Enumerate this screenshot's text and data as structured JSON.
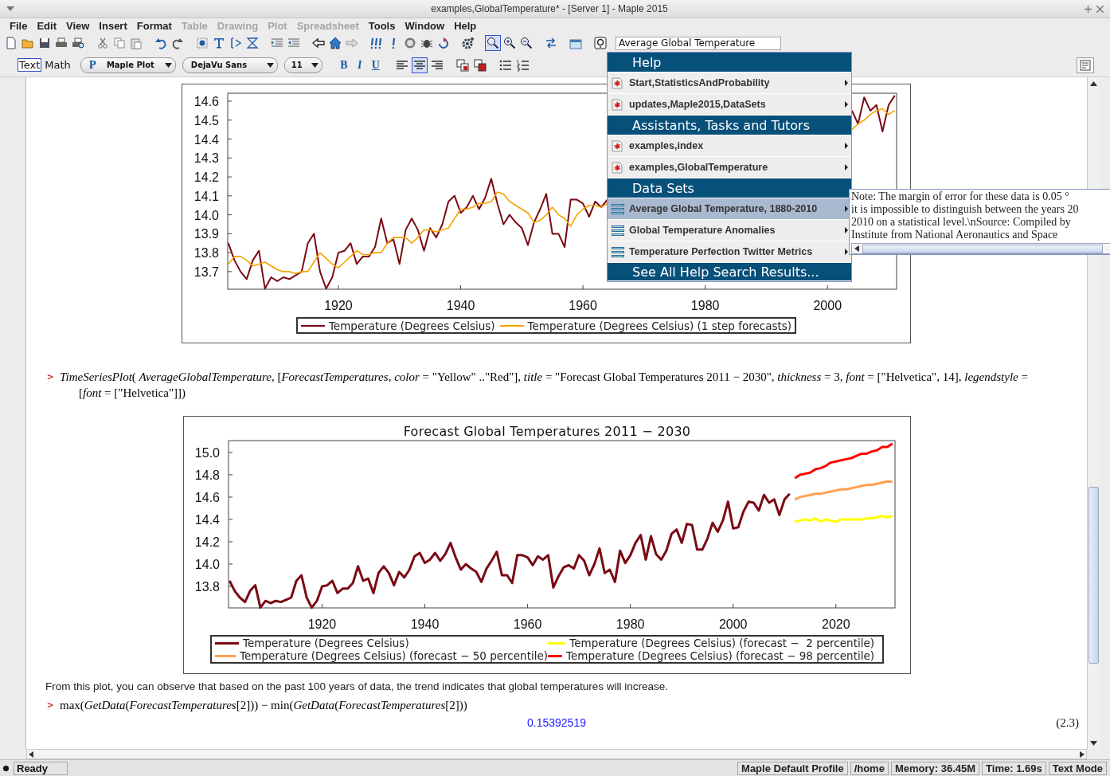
{
  "window": {
    "title": "examples,GlobalTemperature* - [Server 1] - Maple 2015"
  },
  "menu_bar": [
    {
      "label": "File",
      "disabled": false
    },
    {
      "label": "Edit",
      "disabled": false
    },
    {
      "label": "View",
      "disabled": false
    },
    {
      "label": "Insert",
      "disabled": false
    },
    {
      "label": "Format",
      "disabled": false
    },
    {
      "label": "Table",
      "disabled": true
    },
    {
      "label": "Drawing",
      "disabled": true
    },
    {
      "label": "Plot",
      "disabled": true
    },
    {
      "label": "Spreadsheet",
      "disabled": true
    },
    {
      "label": "Tools",
      "disabled": false
    },
    {
      "label": "Window",
      "disabled": false
    },
    {
      "label": "Help",
      "disabled": false
    }
  ],
  "toolbar": {
    "items": [
      {
        "kind": "new",
        "selected": false
      },
      {
        "kind": "open",
        "selected": false
      },
      {
        "kind": "save",
        "selected": false
      },
      {
        "kind": "print",
        "selected": false
      },
      {
        "kind": "preview",
        "selected": false
      },
      {
        "kind": "separator"
      },
      {
        "kind": "cut",
        "selected": false
      },
      {
        "kind": "copy",
        "selected": false
      },
      {
        "kind": "paste",
        "selected": false
      },
      {
        "kind": "separator"
      },
      {
        "kind": "undo",
        "selected": false
      },
      {
        "kind": "redo",
        "selected": false
      },
      {
        "kind": "separator"
      },
      {
        "kind": "group",
        "selected": false
      },
      {
        "kind": "text",
        "selected": false
      },
      {
        "kind": "prompt",
        "selected": false
      },
      {
        "kind": "section",
        "selected": false
      },
      {
        "kind": "separator"
      },
      {
        "kind": "indent",
        "selected": false
      },
      {
        "kind": "outdent",
        "selected": false
      },
      {
        "kind": "separator"
      },
      {
        "kind": "back",
        "selected": false
      },
      {
        "kind": "home",
        "selected": false
      },
      {
        "kind": "forward",
        "selected": false
      },
      {
        "kind": "separator"
      },
      {
        "kind": "execute-all",
        "selected": false
      },
      {
        "kind": "execute",
        "selected": false
      },
      {
        "kind": "stop",
        "selected": false
      },
      {
        "kind": "debug",
        "selected": false
      },
      {
        "kind": "restart",
        "selected": false
      },
      {
        "kind": "separator"
      },
      {
        "kind": "gear",
        "selected": false
      },
      {
        "kind": "separator"
      },
      {
        "kind": "zoom-fit",
        "selected": true
      },
      {
        "kind": "zoom-in",
        "selected": false
      },
      {
        "kind": "zoom-out",
        "selected": false
      },
      {
        "kind": "separator"
      },
      {
        "kind": "swap",
        "selected": false
      },
      {
        "kind": "separator"
      },
      {
        "kind": "insert",
        "selected": false
      },
      {
        "kind": "separator"
      },
      {
        "kind": "help",
        "selected": false
      }
    ],
    "search": {
      "value": "Average Global Temperature"
    }
  },
  "format_bar": {
    "modes": [
      {
        "label": "Text",
        "selected": true
      },
      {
        "label": "Math",
        "selected": false
      }
    ],
    "style": {
      "prefix": "P",
      "value": "Maple Plot"
    },
    "font": {
      "value": "DejaVu Sans"
    },
    "size": {
      "value": "11"
    },
    "text_styles": [
      {
        "label": "B",
        "kind": "bold",
        "selected": false
      },
      {
        "label": "I",
        "kind": "italic",
        "selected": false
      },
      {
        "label": "U",
        "kind": "underline",
        "selected": false
      }
    ],
    "alignments": [
      {
        "kind": "left",
        "selected": false
      },
      {
        "kind": "center",
        "selected": true
      },
      {
        "kind": "right",
        "selected": false
      }
    ]
  },
  "document": {
    "plot_1": {
      "chart_data": {
        "type": "line",
        "legend": "bottom",
        "xlim": [
          1901.9,
          2011.3
        ],
        "ylim": [
          13.607,
          14.642
        ],
        "xticks": [
          1920,
          1940,
          1960,
          1980,
          2000
        ],
        "yticks": [
          13.7,
          13.8,
          13.9,
          {
            "value": 14,
            "label": "14.0"
          },
          14.1,
          14.2,
          14.3,
          14.4,
          14.5,
          14.6
        ],
        "x": [
          1902,
          1903,
          1904,
          1905,
          1906,
          1907,
          1908,
          1909,
          1910,
          1911,
          1912,
          1913,
          1914,
          1915,
          1916,
          1917,
          1918,
          1919,
          1920,
          1921,
          1922,
          1923,
          1924,
          1925,
          1926,
          1927,
          1928,
          1929,
          1930,
          1931,
          1932,
          1933,
          1934,
          1935,
          1936,
          1937,
          1938,
          1939,
          1940,
          1941,
          1942,
          1943,
          1944,
          1945,
          1946,
          1947,
          1948,
          1949,
          1950,
          1951,
          1952,
          1953,
          1954,
          1955,
          1956,
          1957,
          1958,
          1959,
          1960,
          1961,
          1962,
          1963,
          1964,
          null,
          null,
          null,
          null,
          null,
          null,
          null,
          null,
          null,
          null,
          null,
          null,
          null,
          null,
          null,
          null,
          null,
          null,
          null,
          null,
          null,
          null,
          null,
          null,
          null,
          null,
          null,
          null,
          null,
          null,
          null,
          null,
          null,
          null,
          null,
          null,
          null,
          null,
          null,
          2004,
          2005,
          2006,
          2007,
          2008,
          2009,
          2010,
          2011
        ],
        "series": [
          {
            "name": "Temperature (Degrees Celsius)",
            "color": "#7a0a14",
            "values": [
              13.85,
              13.76,
              13.7,
              13.66,
              13.76,
              13.81,
              13.61,
              13.67,
              13.65,
              13.67,
              13.66,
              13.68,
              13.7,
              13.85,
              13.9,
              13.7,
              13.61,
              13.67,
              13.8,
              13.81,
              13.85,
              13.74,
              13.78,
              13.78,
              13.83,
              13.98,
              13.85,
              13.87,
              13.74,
              13.92,
              13.98,
              13.92,
              13.81,
              13.93,
              13.88,
              13.95,
              14.07,
              14.1,
              14.01,
              14.04,
              14.1,
              14.03,
              14.09,
              14.19,
              14.06,
              13.95,
              14.0,
              13.96,
              13.93,
              13.84,
              13.96,
              14.03,
              14.11,
              13.9,
              13.9,
              13.83,
              14.08,
              14.08,
              14.06,
              13.99,
              14.07,
              14.04,
              14.08,
              null,
              null,
              null,
              null,
              null,
              null,
              null,
              null,
              null,
              null,
              null,
              null,
              null,
              null,
              null,
              null,
              null,
              null,
              null,
              null,
              null,
              null,
              null,
              null,
              null,
              null,
              null,
              null,
              null,
              null,
              null,
              null,
              null,
              null,
              null,
              null,
              null,
              null,
              null,
              14.55,
              14.48,
              14.62,
              14.55,
              14.58,
              14.44,
              14.58,
              14.63
            ]
          },
          {
            "name": "Temperature (Degrees Celsius) (1 step forecasts)",
            "color": "#f5a300",
            "values": [
              13.74,
              13.78,
              13.78,
              13.76,
              13.73,
              13.74,
              13.75,
              13.73,
              13.71,
              13.7,
              13.7,
              13.69,
              13.7,
              13.7,
              13.75,
              13.8,
              13.77,
              13.74,
              13.72,
              13.75,
              13.78,
              13.81,
              13.79,
              13.79,
              13.8,
              13.8,
              13.85,
              13.88,
              13.88,
              13.88,
              13.85,
              13.88,
              13.92,
              13.92,
              13.91,
              13.92,
              13.93,
              13.98,
              14.03,
              14.03,
              14.04,
              14.06,
              14.06,
              14.07,
              14.12,
              14.11,
              14.07,
              14.05,
              14.03,
              14.01,
              13.96,
              13.97,
              14.0,
              14.04,
              14.0,
              13.98,
              13.94,
              14.0,
              14.03,
              14.05,
              14.05,
              14.04,
              14.06,
              null,
              null,
              null,
              null,
              null,
              null,
              null,
              null,
              null,
              null,
              null,
              null,
              null,
              null,
              null,
              null,
              null,
              null,
              null,
              null,
              null,
              null,
              null,
              null,
              null,
              null,
              null,
              null,
              null,
              null,
              null,
              null,
              null,
              null,
              null,
              null,
              null,
              null,
              null,
              14.45,
              14.48,
              14.5,
              14.53,
              14.55,
              14.56,
              14.53,
              14.55
            ]
          }
        ]
      }
    },
    "input_1": {
      "prompt": ">",
      "text": "*TimeSeriesPlot*( *AverageGlobalTemperature*, [*ForecastTemperatures*, *color* = \"Yellow\" ..\"Red\"], *title* = \"Forecast Global Temperatures 2011 − 2030\", *thickness* = 3, *font* = [\"Helvetica\", 14], *legendstyle* = [*font* = [\"Helvetica\"]])"
    },
    "plot_2": {
      "chart_data": {
        "type": "line",
        "legend": "bottom",
        "title": "Forecast Global Temperatures 2011 − 2030",
        "xlim": [
          1901.8,
          2031.5
        ],
        "ylim": [
          13.607,
          15.107
        ],
        "xticks": [
          1920,
          1940,
          1960,
          1980,
          2000,
          2020
        ],
        "yticks": [
          13.8,
          {
            "value": 14,
            "label": "14.0"
          },
          14.2,
          14.4,
          14.6,
          14.8,
          {
            "value": 15,
            "label": "15.0"
          }
        ],
        "x": [
          1902,
          1903,
          1904,
          1905,
          1906,
          1907,
          1908,
          1909,
          1910,
          1911,
          1912,
          1913,
          1914,
          1915,
          1916,
          1917,
          1918,
          1919,
          1920,
          1921,
          1922,
          1923,
          1924,
          1925,
          1926,
          1927,
          1928,
          1929,
          1930,
          1931,
          1932,
          1933,
          1934,
          1935,
          1936,
          1937,
          1938,
          1939,
          1940,
          1941,
          1942,
          1943,
          1944,
          1945,
          1946,
          1947,
          1948,
          1949,
          1950,
          1951,
          1952,
          1953,
          1954,
          1955,
          1956,
          1957,
          1958,
          1959,
          1960,
          1961,
          1962,
          1963,
          1964,
          1965,
          1966,
          1967,
          1968,
          1969,
          1970,
          1971,
          1972,
          1973,
          1974,
          1975,
          1976,
          1977,
          1978,
          1979,
          1980,
          1981,
          1982,
          1983,
          1984,
          1985,
          1986,
          1987,
          1988,
          1989,
          1990,
          1991,
          1992,
          1993,
          1994,
          1995,
          1996,
          1997,
          1998,
          1999,
          2000,
          2001,
          2002,
          2003,
          2004,
          2005,
          2006,
          2007,
          2008,
          2009,
          2010,
          2011,
          2012,
          2013,
          2014,
          2015,
          2016,
          2017,
          2018,
          2019,
          2020,
          2021,
          2022,
          2023,
          2024,
          2025,
          2026,
          2027,
          2028,
          2029,
          2030,
          2031
        ],
        "series": [
          {
            "name": "Temperature (Degrees Celsius)",
            "color": "#7a0a14",
            "values": [
              13.85,
              13.76,
              13.7,
              13.66,
              13.76,
              13.81,
              13.61,
              13.67,
              13.65,
              13.67,
              13.66,
              13.68,
              13.7,
              13.85,
              13.9,
              13.7,
              13.61,
              13.67,
              13.8,
              13.81,
              13.85,
              13.74,
              13.78,
              13.78,
              13.83,
              13.98,
              13.85,
              13.87,
              13.74,
              13.92,
              13.98,
              13.92,
              13.81,
              13.93,
              13.88,
              13.95,
              14.07,
              14.1,
              14.01,
              14.04,
              14.1,
              14.03,
              14.09,
              14.19,
              14.06,
              13.95,
              14.0,
              13.96,
              13.93,
              13.84,
              13.96,
              14.03,
              14.11,
              13.9,
              13.9,
              13.83,
              14.08,
              14.08,
              14.06,
              13.99,
              14.07,
              14.04,
              14.08,
              13.79,
              13.89,
              13.97,
              13.99,
              13.96,
              14.08,
              14.03,
              13.9,
              14.0,
              14.14,
              13.92,
              13.95,
              13.84,
              14.12,
              14.01,
              14.08,
              14.19,
              14.26,
              14.04,
              14.25,
              14.09,
              14.04,
              14.12,
              14.27,
              14.31,
              14.19,
              14.36,
              14.35,
              14.13,
              14.13,
              14.23,
              14.37,
              14.29,
              14.39,
              14.56,
              14.32,
              14.33,
              14.47,
              14.56,
              14.55,
              14.48,
              14.62,
              14.55,
              14.58,
              14.44,
              14.58,
              14.63,
              null,
              null,
              null,
              null,
              null,
              null,
              null,
              null,
              null,
              null,
              null,
              null,
              null,
              null,
              null,
              null,
              null,
              null,
              null,
              null
            ]
          },
          {
            "name": "Temperature (Degrees Celsius) (forecast −  2 percentile)",
            "color": "#ffff00",
            "values": [
              null,
              null,
              null,
              null,
              null,
              null,
              null,
              null,
              null,
              null,
              null,
              null,
              null,
              null,
              null,
              null,
              null,
              null,
              null,
              null,
              null,
              null,
              null,
              null,
              null,
              null,
              null,
              null,
              null,
              null,
              null,
              null,
              null,
              null,
              null,
              null,
              null,
              null,
              null,
              null,
              null,
              null,
              null,
              null,
              null,
              null,
              null,
              null,
              null,
              null,
              null,
              null,
              null,
              null,
              null,
              null,
              null,
              null,
              null,
              null,
              null,
              null,
              null,
              null,
              null,
              null,
              null,
              null,
              null,
              null,
              null,
              null,
              null,
              null,
              null,
              null,
              null,
              null,
              null,
              null,
              null,
              null,
              null,
              null,
              null,
              null,
              null,
              null,
              null,
              null,
              null,
              null,
              null,
              null,
              null,
              null,
              null,
              null,
              null,
              null,
              null,
              null,
              null,
              null,
              null,
              null,
              null,
              null,
              null,
              null,
              14.38,
              14.39,
              14.4,
              14.39,
              14.41,
              14.38,
              14.4,
              14.39,
              14.38,
              14.4,
              14.4,
              14.4,
              14.4,
              14.4,
              14.41,
              14.41,
              14.42,
              14.43,
              14.42,
              14.43
            ]
          },
          {
            "name": "Temperature (Degrees Celsius) (forecast − 50 percentile)",
            "color": "#ffa050",
            "values": [
              null,
              null,
              null,
              null,
              null,
              null,
              null,
              null,
              null,
              null,
              null,
              null,
              null,
              null,
              null,
              null,
              null,
              null,
              null,
              null,
              null,
              null,
              null,
              null,
              null,
              null,
              null,
              null,
              null,
              null,
              null,
              null,
              null,
              null,
              null,
              null,
              null,
              null,
              null,
              null,
              null,
              null,
              null,
              null,
              null,
              null,
              null,
              null,
              null,
              null,
              null,
              null,
              null,
              null,
              null,
              null,
              null,
              null,
              null,
              null,
              null,
              null,
              null,
              null,
              null,
              null,
              null,
              null,
              null,
              null,
              null,
              null,
              null,
              null,
              null,
              null,
              null,
              null,
              null,
              null,
              null,
              null,
              null,
              null,
              null,
              null,
              null,
              null,
              null,
              null,
              null,
              null,
              null,
              null,
              null,
              null,
              null,
              null,
              null,
              null,
              null,
              null,
              null,
              null,
              null,
              null,
              null,
              null,
              null,
              null,
              14.58,
              14.6,
              14.61,
              14.62,
              14.63,
              14.63,
              14.64,
              14.65,
              14.66,
              14.67,
              14.67,
              14.68,
              14.69,
              14.7,
              14.71,
              14.71,
              14.72,
              14.73,
              14.74,
              14.74
            ]
          },
          {
            "name": "Temperature (Degrees Celsius) (forecast − 98 percentile)",
            "color": "#ff0000",
            "values": [
              null,
              null,
              null,
              null,
              null,
              null,
              null,
              null,
              null,
              null,
              null,
              null,
              null,
              null,
              null,
              null,
              null,
              null,
              null,
              null,
              null,
              null,
              null,
              null,
              null,
              null,
              null,
              null,
              null,
              null,
              null,
              null,
              null,
              null,
              null,
              null,
              null,
              null,
              null,
              null,
              null,
              null,
              null,
              null,
              null,
              null,
              null,
              null,
              null,
              null,
              null,
              null,
              null,
              null,
              null,
              null,
              null,
              null,
              null,
              null,
              null,
              null,
              null,
              null,
              null,
              null,
              null,
              null,
              null,
              null,
              null,
              null,
              null,
              null,
              null,
              null,
              null,
              null,
              null,
              null,
              null,
              null,
              null,
              null,
              null,
              null,
              null,
              null,
              null,
              null,
              null,
              null,
              null,
              null,
              null,
              null,
              null,
              null,
              null,
              null,
              null,
              null,
              null,
              null,
              null,
              null,
              null,
              null,
              null,
              null,
              14.77,
              14.8,
              14.81,
              14.82,
              14.85,
              14.86,
              14.88,
              14.91,
              14.92,
              14.93,
              14.94,
              14.95,
              14.97,
              14.99,
              14.99,
              15.01,
              15.02,
              15.05,
              15.05,
              15.08
            ]
          }
        ]
      }
    },
    "paragraph": "From this plot, you can observe that based on the past 100 years of data, the trend indicates that global temperatures will increase.",
    "input_2": {
      "prompt": ">",
      "text": "max(*GetData*(*ForecastTemperatures*[2])) − min(*GetData*(*ForecastTemperatures*[2]))"
    },
    "output": {
      "value": "0.15392519",
      "label": "(2.3)"
    }
  },
  "popup": {
    "items": [
      {
        "kind": "header",
        "label": "Help"
      },
      {
        "kind": "page",
        "label": "Start,StatisticsAndProbability",
        "selected": false
      },
      {
        "kind": "page",
        "label": "updates,Maple2015,DataSets",
        "selected": false
      },
      {
        "kind": "header",
        "label": "Assistants, Tasks and Tutors"
      },
      {
        "kind": "page",
        "label": "examples,index",
        "selected": false
      },
      {
        "kind": "page",
        "label": "examples,GlobalTemperature",
        "selected": false
      },
      {
        "kind": "header",
        "label": "Data Sets"
      },
      {
        "kind": "dataset",
        "label": "Average Global Temperature, 1880-2010",
        "selected": true
      },
      {
        "kind": "dataset",
        "label": "Global Temperature Anomalies",
        "selected": false
      },
      {
        "kind": "dataset",
        "label": "Temperature Perfection Twitter Metrics",
        "selected": false
      },
      {
        "kind": "action",
        "label": "See All Help Search Results..."
      }
    ]
  },
  "tooltip": {
    "lines": [
      "Note: The margin of error for these data is 0.05 °",
      "it is impossible to distinguish between the years 20",
      "2010 on a statistical level.\\nSource: Compiled by",
      "Institute from National Aeronautics and Space"
    ]
  },
  "status_bar": {
    "message": "Ready",
    "fields": [
      "Maple Default Profile",
      "/home",
      "Memory: 36.45M",
      "Time: 1.69s",
      "Text Mode"
    ]
  }
}
